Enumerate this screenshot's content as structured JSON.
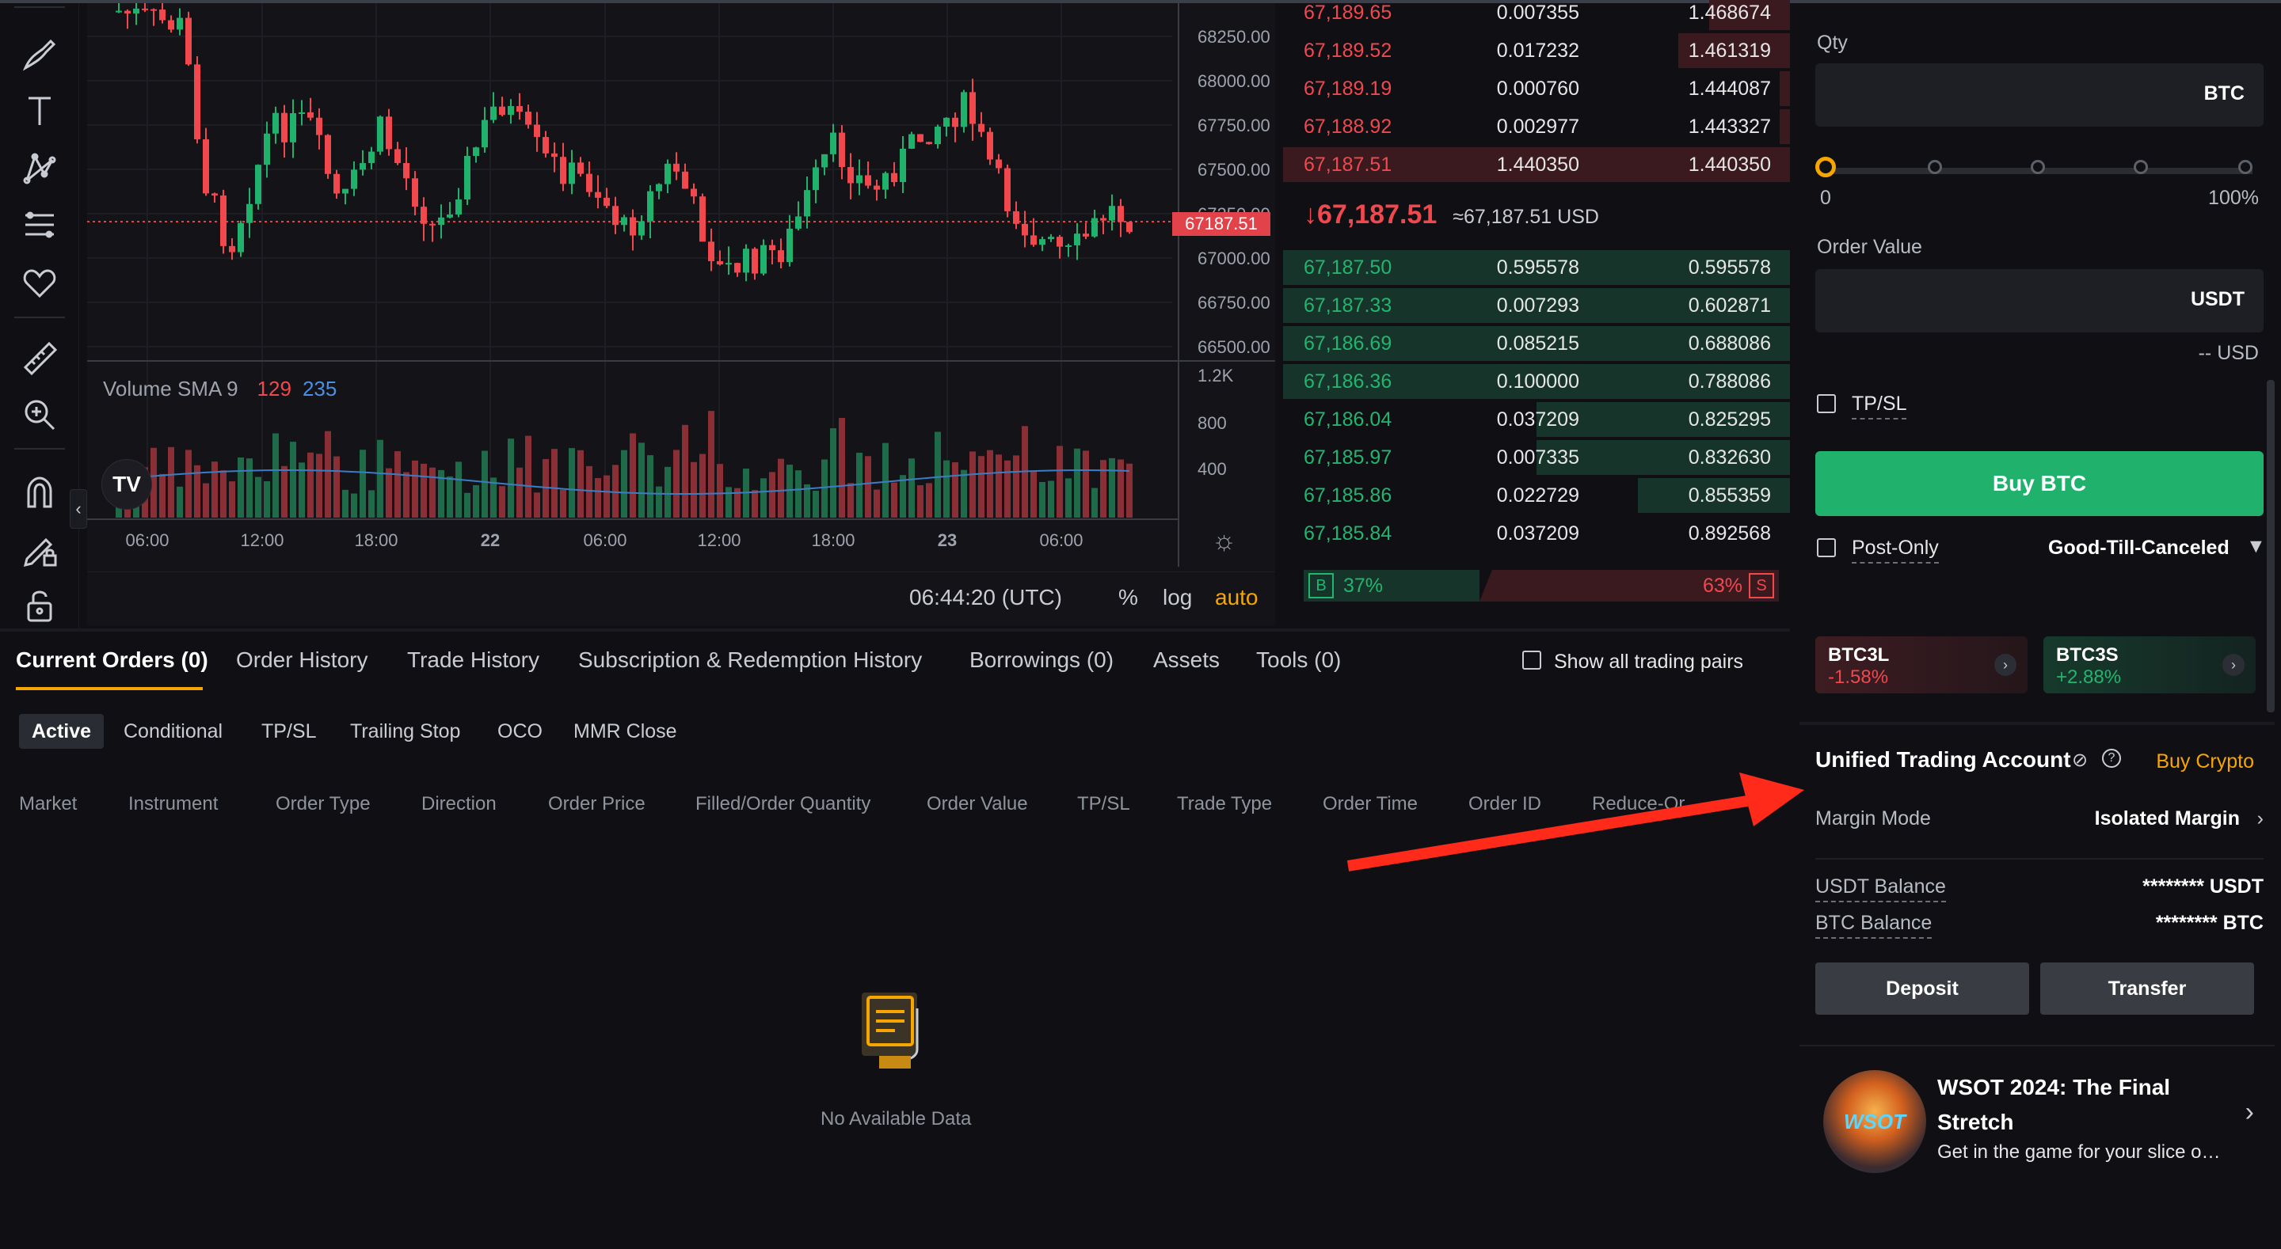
{
  "chart": {
    "price_axis": [
      "68250.00",
      "68000.00",
      "67750.00",
      "67500.00",
      "67250.00",
      "67000.00",
      "66750.00",
      "66500.00"
    ],
    "current_price_tag": "67187.51",
    "volume_axis": [
      "1.2K",
      "800",
      "400"
    ],
    "time_axis": [
      "06:00",
      "12:00",
      "18:00",
      "22",
      "06:00",
      "12:00",
      "18:00",
      "23",
      "06:00"
    ],
    "volume_legend": {
      "label": "Volume SMA 9",
      "v1": "129",
      "v2": "235"
    },
    "utc_time": "06:44:20 (UTC)",
    "options": {
      "percent": "%",
      "log": "log",
      "auto": "auto"
    },
    "logo": "TV"
  },
  "order_book": {
    "asks": [
      {
        "price": "67,189.65",
        "qty": "0.007355",
        "total": "1.468674",
        "depth": 0.16
      },
      {
        "price": "67,189.52",
        "qty": "0.017232",
        "total": "1.461319",
        "depth": 0.22
      },
      {
        "price": "67,189.19",
        "qty": "0.000760",
        "total": "1.444087",
        "depth": 0.02
      },
      {
        "price": "67,188.92",
        "qty": "0.002977",
        "total": "1.443327",
        "depth": 0.02
      },
      {
        "price": "67,187.51",
        "qty": "1.440350",
        "total": "1.440350",
        "depth": 1.0
      }
    ],
    "mid_price": "67,187.51",
    "mid_usd": "≈67,187.51 USD",
    "bids": [
      {
        "price": "67,187.50",
        "qty": "0.595578",
        "total": "0.595578",
        "depth": 1.0
      },
      {
        "price": "67,187.33",
        "qty": "0.007293",
        "total": "0.602871",
        "depth": 1.0
      },
      {
        "price": "67,186.69",
        "qty": "0.085215",
        "total": "0.688086",
        "depth": 1.0
      },
      {
        "price": "67,186.36",
        "qty": "0.100000",
        "total": "0.788086",
        "depth": 1.0
      },
      {
        "price": "67,186.04",
        "qty": "0.037209",
        "total": "0.825295",
        "depth": 0.5
      },
      {
        "price": "67,185.97",
        "qty": "0.007335",
        "total": "0.832630",
        "depth": 0.5
      },
      {
        "price": "67,185.86",
        "qty": "0.022729",
        "total": "0.855359",
        "depth": 0.3
      },
      {
        "price": "67,185.84",
        "qty": "0.037209",
        "total": "0.892568",
        "depth": 0.0
      }
    ],
    "buy_label": "B",
    "buy_pct": "37%",
    "sell_pct": "63%",
    "sell_label": "S"
  },
  "trade_panel": {
    "qty_label": "Qty",
    "qty_unit": "BTC",
    "slider_min": "0",
    "slider_max": "100%",
    "slider_value": 0,
    "order_value_label": "Order Value",
    "order_value_unit": "USDT",
    "usd_hint": "-- USD",
    "tpsl_label": "TP/SL",
    "buy_button": "Buy BTC",
    "post_only_label": "Post-Only",
    "tif_label": "Good-Till-Canceled",
    "lev_tokens": [
      {
        "name": "BTC3L",
        "change": "-1.58%",
        "color": "#f1484e"
      },
      {
        "name": "BTC3S",
        "change": "+2.88%",
        "color": "#22b56f"
      }
    ]
  },
  "account": {
    "title": "Unified Trading Account",
    "buy_crypto": "Buy Crypto",
    "margin_mode_label": "Margin Mode",
    "margin_mode_value": "Isolated Margin",
    "usdt_balance_label": "USDT Balance",
    "usdt_balance_value": "******** USDT",
    "btc_balance_label": "BTC Balance",
    "btc_balance_value": "******** BTC",
    "deposit": "Deposit",
    "transfer": "Transfer"
  },
  "promo": {
    "logo_text": "WSOT",
    "title": "WSOT 2024: The Final Stretch",
    "subtitle": "Get in the game for your slice of t..."
  },
  "orders": {
    "tabs": [
      "Current Orders (0)",
      "Order History",
      "Trade History",
      "Subscription & Redemption History",
      "Borrowings (0)",
      "Assets",
      "Tools (0)"
    ],
    "show_all": "Show all trading pairs",
    "subtabs": [
      "Active",
      "Conditional",
      "TP/SL",
      "Trailing Stop",
      "OCO",
      "MMR Close"
    ],
    "columns": [
      "Market",
      "Instrument",
      "Order Type",
      "Direction",
      "Order Price",
      "Filled/Order Quantity",
      "Order Value",
      "TP/SL",
      "Trade Type",
      "Order Time",
      "Order ID",
      "Reduce-Or"
    ],
    "empty_text": "No Available Data"
  },
  "colors": {
    "accent": "#f7a600",
    "buy": "#20b26c",
    "sell": "#f1484e",
    "annotation_arrow": "#ff2a1a"
  }
}
